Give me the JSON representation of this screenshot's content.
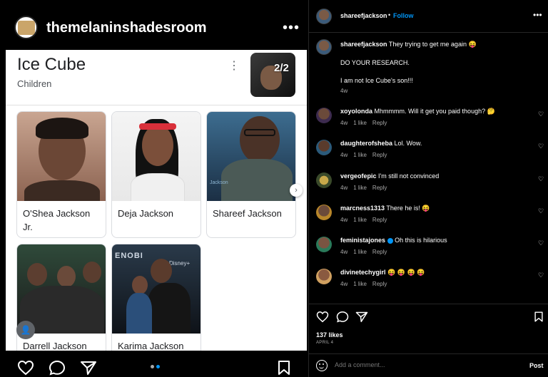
{
  "left_post": {
    "account_name": "themelaninshadesroom",
    "more_icon": "ellipsis-icon"
  },
  "knowledge_panel": {
    "title": "Ice Cube",
    "subtitle": "Children",
    "image_counter": "2/2",
    "children": [
      {
        "name": "O'Shea Jackson Jr."
      },
      {
        "name": "Deja Jackson"
      },
      {
        "name": "Shareef Jackson"
      },
      {
        "name": "Darrell Jackson"
      },
      {
        "name": "Karima Jackson"
      }
    ]
  },
  "left_actions": {
    "icons": [
      "heart-icon",
      "comment-icon",
      "share-icon",
      "bookmark-icon"
    ]
  },
  "right_post": {
    "username": "shareefjackson",
    "follow_label": "Follow",
    "dot": "•",
    "caption": {
      "username": "shareefjackson",
      "line1": "They trying to get me again 😝",
      "line2": "DO YOUR RESEARCH.",
      "line3": "I am not Ice Cube's son!!!",
      "time": "4w"
    },
    "comments": [
      {
        "user": "xoyolonda",
        "text": "Mhmmmm. Will it get you paid though? 🤔",
        "time": "4w",
        "likes": "1 like",
        "reply": "Reply"
      },
      {
        "user": "daughterofsheba",
        "text": "Lol. Wow.",
        "time": "4w",
        "likes": "1 like",
        "reply": "Reply"
      },
      {
        "user": "vergeofepic",
        "text": "I'm still not convinced",
        "time": "4w",
        "likes": "1 like",
        "reply": "Reply"
      },
      {
        "user": "marcness1313",
        "text": "There he is! 😝",
        "time": "4w",
        "likes": "1 like",
        "reply": "Reply"
      },
      {
        "user": "feministajones",
        "text": "Oh this is hilarious",
        "time": "4w",
        "likes": "1 like",
        "reply": "Reply"
      },
      {
        "user": "divinetechygirl",
        "text": "😝 😝 😝 😝",
        "time": "4w",
        "likes": "1 like",
        "reply": "Reply"
      }
    ],
    "likes_count": "137 likes",
    "date": "APRIL 4",
    "add_comment_placeholder": "Add a comment...",
    "post_label": "Post"
  },
  "colors": {
    "accent": "#0095f6",
    "background": "#000000",
    "card": "#ffffff"
  }
}
